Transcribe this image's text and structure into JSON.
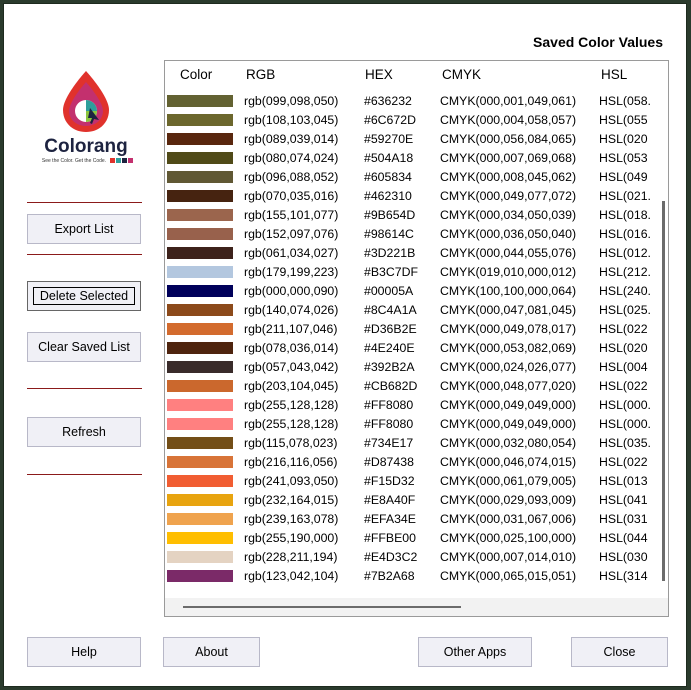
{
  "window": {
    "title": "Saved Color Values"
  },
  "logo": {
    "brand": "Colorang",
    "tagline": "See the Color. Get the Code.",
    "squares": [
      "#e0322c",
      "#2e9e9b",
      "#1d2340",
      "#c3306e"
    ]
  },
  "buttons": {
    "export": "Export List",
    "delete": "Delete Selected",
    "clear": "Clear Saved List",
    "refresh": "Refresh",
    "help": "Help",
    "about": "About",
    "other_apps": "Other Apps",
    "close": "Close"
  },
  "table": {
    "headers": [
      "Color",
      "RGB",
      "HEX",
      "CMYK",
      "HSL"
    ],
    "rows": [
      {
        "color": "#636232",
        "rgb": "rgb(099,098,050)",
        "hex": "#636232",
        "cmyk": "CMYK(000,001,049,061)",
        "hsl": "HSL(058."
      },
      {
        "color": "#6C672D",
        "rgb": "rgb(108,103,045)",
        "hex": "#6C672D",
        "cmyk": "CMYK(000,004,058,057)",
        "hsl": "HSL(055"
      },
      {
        "color": "#59270E",
        "rgb": "rgb(089,039,014)",
        "hex": "#59270E",
        "cmyk": "CMYK(000,056,084,065)",
        "hsl": "HSL(020"
      },
      {
        "color": "#504A18",
        "rgb": "rgb(080,074,024)",
        "hex": "#504A18",
        "cmyk": "CMYK(000,007,069,068)",
        "hsl": "HSL(053"
      },
      {
        "color": "#605834",
        "rgb": "rgb(096,088,052)",
        "hex": "#605834",
        "cmyk": "CMYK(000,008,045,062)",
        "hsl": "HSL(049"
      },
      {
        "color": "#462310",
        "rgb": "rgb(070,035,016)",
        "hex": "#462310",
        "cmyk": "CMYK(000,049,077,072)",
        "hsl": "HSL(021."
      },
      {
        "color": "#9B654D",
        "rgb": "rgb(155,101,077)",
        "hex": "#9B654D",
        "cmyk": "CMYK(000,034,050,039)",
        "hsl": "HSL(018."
      },
      {
        "color": "#98614C",
        "rgb": "rgb(152,097,076)",
        "hex": "#98614C",
        "cmyk": "CMYK(000,036,050,040)",
        "hsl": "HSL(016."
      },
      {
        "color": "#3D221B",
        "rgb": "rgb(061,034,027)",
        "hex": "#3D221B",
        "cmyk": "CMYK(000,044,055,076)",
        "hsl": "HSL(012."
      },
      {
        "color": "#B3C7DF",
        "rgb": "rgb(179,199,223)",
        "hex": "#B3C7DF",
        "cmyk": "CMYK(019,010,000,012)",
        "hsl": "HSL(212."
      },
      {
        "color": "#00005A",
        "rgb": "rgb(000,000,090)",
        "hex": "#00005A",
        "cmyk": "CMYK(100,100,000,064)",
        "hsl": "HSL(240."
      },
      {
        "color": "#8C4A1A",
        "rgb": "rgb(140,074,026)",
        "hex": "#8C4A1A",
        "cmyk": "CMYK(000,047,081,045)",
        "hsl": "HSL(025."
      },
      {
        "color": "#D36B2E",
        "rgb": "rgb(211,107,046)",
        "hex": "#D36B2E",
        "cmyk": "CMYK(000,049,078,017)",
        "hsl": "HSL(022"
      },
      {
        "color": "#4E240E",
        "rgb": "rgb(078,036,014)",
        "hex": "#4E240E",
        "cmyk": "CMYK(000,053,082,069)",
        "hsl": "HSL(020"
      },
      {
        "color": "#392B2A",
        "rgb": "rgb(057,043,042)",
        "hex": "#392B2A",
        "cmyk": "CMYK(000,024,026,077)",
        "hsl": "HSL(004"
      },
      {
        "color": "#CB682D",
        "rgb": "rgb(203,104,045)",
        "hex": "#CB682D",
        "cmyk": "CMYK(000,048,077,020)",
        "hsl": "HSL(022"
      },
      {
        "color": "#FF8080",
        "rgb": "rgb(255,128,128)",
        "hex": "#FF8080",
        "cmyk": "CMYK(000,049,049,000)",
        "hsl": "HSL(000."
      },
      {
        "color": "#FF8080",
        "rgb": "rgb(255,128,128)",
        "hex": "#FF8080",
        "cmyk": "CMYK(000,049,049,000)",
        "hsl": "HSL(000."
      },
      {
        "color": "#734E17",
        "rgb": "rgb(115,078,023)",
        "hex": "#734E17",
        "cmyk": "CMYK(000,032,080,054)",
        "hsl": "HSL(035."
      },
      {
        "color": "#D87438",
        "rgb": "rgb(216,116,056)",
        "hex": "#D87438",
        "cmyk": "CMYK(000,046,074,015)",
        "hsl": "HSL(022"
      },
      {
        "color": "#F15D32",
        "rgb": "rgb(241,093,050)",
        "hex": "#F15D32",
        "cmyk": "CMYK(000,061,079,005)",
        "hsl": "HSL(013"
      },
      {
        "color": "#E8A40F",
        "rgb": "rgb(232,164,015)",
        "hex": "#E8A40F",
        "cmyk": "CMYK(000,029,093,009)",
        "hsl": "HSL(041"
      },
      {
        "color": "#EFA34E",
        "rgb": "rgb(239,163,078)",
        "hex": "#EFA34E",
        "cmyk": "CMYK(000,031,067,006)",
        "hsl": "HSL(031"
      },
      {
        "color": "#FFBE00",
        "rgb": "rgb(255,190,000)",
        "hex": "#FFBE00",
        "cmyk": "CMYK(000,025,100,000)",
        "hsl": "HSL(044"
      },
      {
        "color": "#E4D3C2",
        "rgb": "rgb(228,211,194)",
        "hex": "#E4D3C2",
        "cmyk": "CMYK(000,007,014,010)",
        "hsl": "HSL(030"
      },
      {
        "color": "#7B2A68",
        "rgb": "rgb(123,042,104)",
        "hex": "#7B2A68",
        "cmyk": "CMYK(000,065,015,051)",
        "hsl": "HSL(314"
      }
    ]
  }
}
